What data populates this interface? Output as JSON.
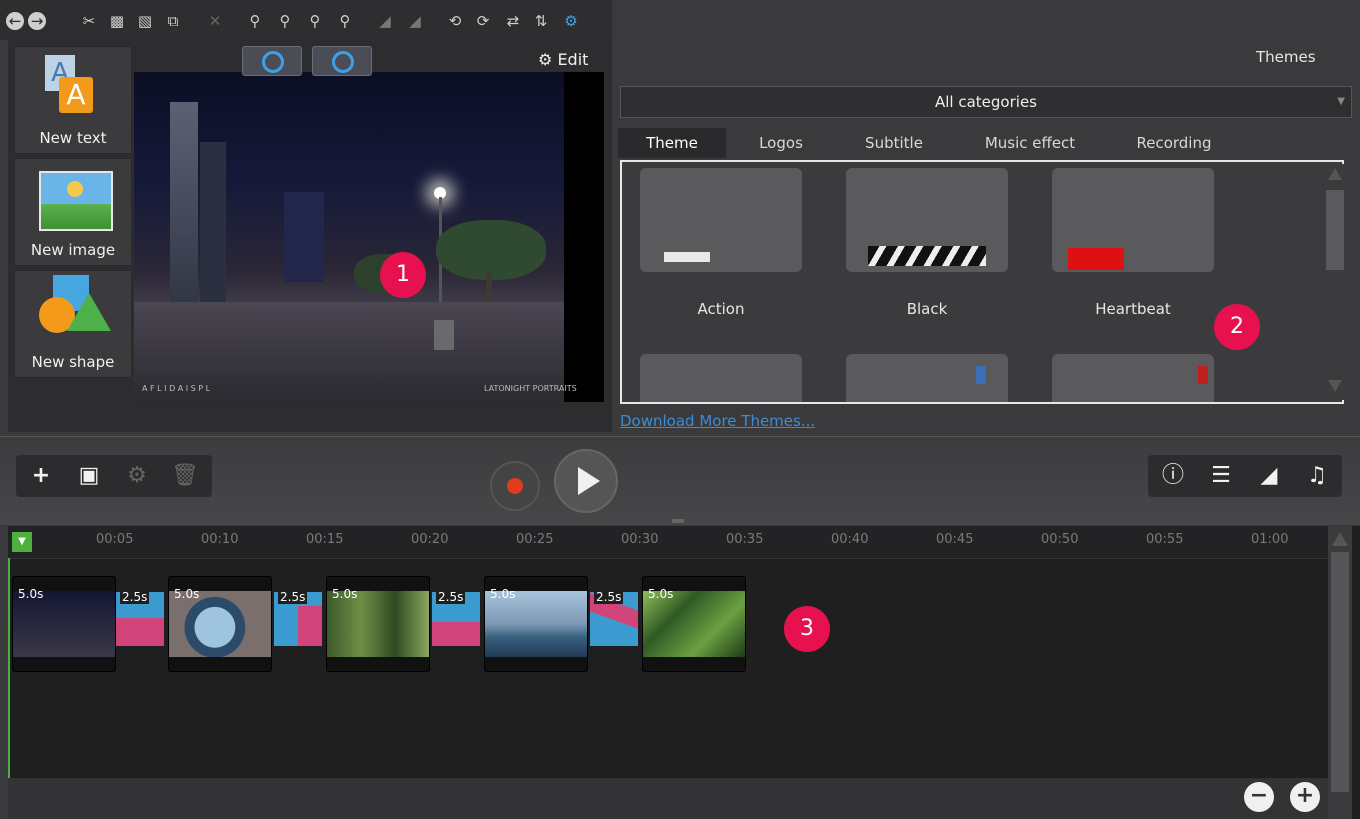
{
  "preview": {
    "edit_label": "Edit",
    "side_buttons": [
      "New text",
      "New image",
      "New shape"
    ],
    "watermark_left": "A F L I D A I S P L",
    "watermark_right": "LATONIGHT PORTRAITS"
  },
  "themes": {
    "title": "Themes",
    "category": "All categories",
    "tabs": [
      "Theme",
      "Logos",
      "Subtitle",
      "Music effect",
      "Recording"
    ],
    "items": [
      "Action",
      "Black",
      "Heartbeat"
    ],
    "download_link": "Download More Themes..."
  },
  "timeline": {
    "ruler": [
      "00:05",
      "00:10",
      "00:15",
      "00:20",
      "00:25",
      "00:30",
      "00:35",
      "00:40",
      "00:45",
      "00:50",
      "00:55",
      "01:00"
    ],
    "clip_durations": [
      "5.0s",
      "5.0s",
      "5.0s",
      "5.0s",
      "5.0s"
    ],
    "transition_durations": [
      "2.5s",
      "2.5s",
      "2.5s",
      "2.5s"
    ]
  },
  "annotations": [
    "1",
    "2",
    "3"
  ]
}
